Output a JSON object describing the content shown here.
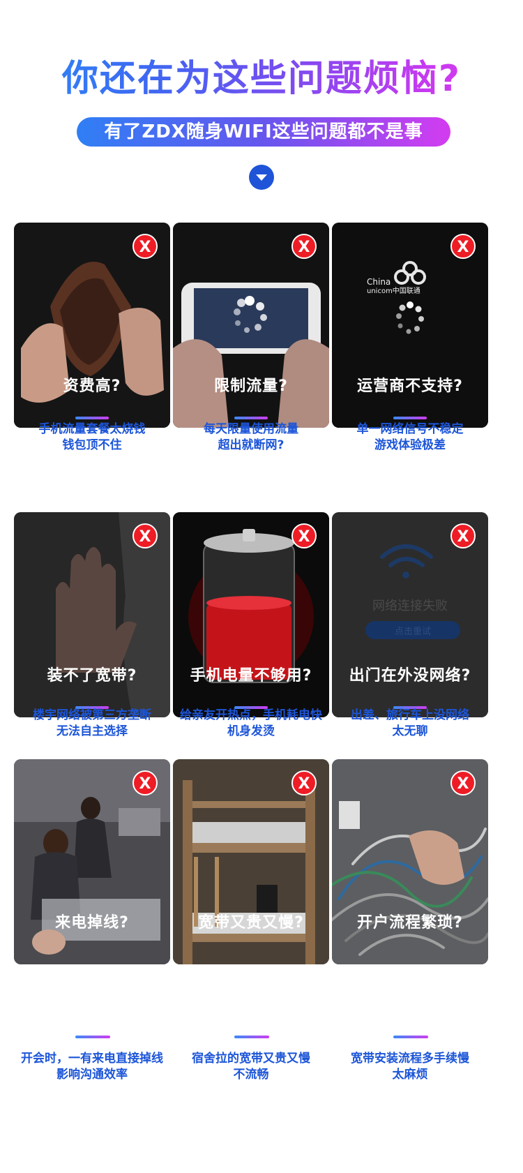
{
  "header": {
    "headline": "你还在为这些问题烦恼?",
    "subtitle": "有了ZDX随身WIFI这些问题都不是事"
  },
  "badge_symbol": "X",
  "cards": [
    {
      "caption": "资费高?",
      "desc1": "手机流量套餐太烧钱",
      "desc2": "钱包顶不住"
    },
    {
      "caption": "限制流量?",
      "desc1": "每天限量使用流量",
      "desc2": "超出就断网?"
    },
    {
      "caption": "运营商不支持?",
      "desc1": "单一网络信号不稳定",
      "desc2": "游戏体验极差"
    },
    {
      "caption": "装不了宽带?",
      "desc1": "楼宇网络被第三方垄断",
      "desc2": "无法自主选择"
    },
    {
      "caption": "手机电量不够用?",
      "desc1": "给亲友开热点，手机耗电快",
      "desc2": "机身发烫"
    },
    {
      "caption": "出门在外没网络?",
      "desc1": "出差、旅行车上没网络",
      "desc2": "太无聊"
    },
    {
      "caption": "来电掉线?",
      "desc1": "开会时，一有来电直接掉线",
      "desc2": "影响沟通效率"
    },
    {
      "caption": "宽带又贵又慢?",
      "desc1": "宿舍拉的宽带又贵又慢",
      "desc2": "不流畅"
    },
    {
      "caption": "开户流程繁琐?",
      "desc1": "宽带安装流程多手续慢",
      "desc2": "太麻烦"
    }
  ],
  "unicom": {
    "line1": "China",
    "line2": "unicom中国联通"
  },
  "network_fail": {
    "text": "网络连接失败",
    "button": "点击重试"
  },
  "colors": {
    "accent_blue": "#1c55d8",
    "badge_red": "#ee1c25",
    "card_dark": "#141414"
  }
}
